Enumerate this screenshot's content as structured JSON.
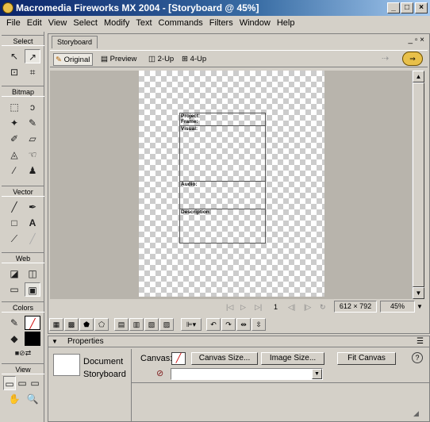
{
  "window": {
    "title": "Macromedia Fireworks MX 2004 - [Storyboard @ 45%]",
    "minimize": "_",
    "maximize": "□",
    "close": "×"
  },
  "menu": [
    "File",
    "Edit",
    "View",
    "Select",
    "Modify",
    "Text",
    "Commands",
    "Filters",
    "Window",
    "Help"
  ],
  "tools": {
    "sections": [
      "Select",
      "Bitmap",
      "Vector",
      "Web",
      "Colors",
      "View"
    ]
  },
  "document": {
    "tab": "Storyboard",
    "view_tabs": [
      "Original",
      "Preview",
      "2-Up",
      "4-Up"
    ],
    "board": {
      "project_label": "Project:",
      "frame_label": "Frame:",
      "visual_label": "Visual:",
      "audio_label": "Audio:",
      "description_label": "Description:"
    },
    "status": {
      "frame": "1",
      "size": "612 × 792",
      "zoom": "45%"
    }
  },
  "properties": {
    "panel_title": "Properties",
    "doc_type": "Document",
    "doc_name": "Storyboard",
    "canvas_label": "Canvas:",
    "canvas_size_button": "Canvas Size...",
    "image_size_button": "Image Size...",
    "fit_canvas_button": "Fit Canvas",
    "help": "?"
  },
  "colors": {
    "title_gradient_start": "#0a246a",
    "title_gradient_end": "#a6caf0",
    "chrome": "#d4d0c8"
  }
}
